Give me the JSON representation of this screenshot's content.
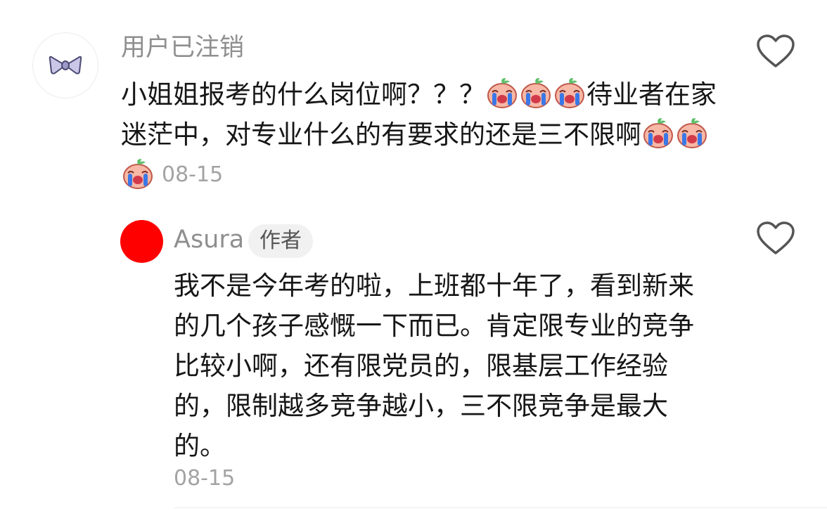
{
  "comment": {
    "username": "用户已注销",
    "text_part1": "小姐姐报考的什么岗位啊？？？",
    "text_part2": "待业者在家迷茫中，对专业什么的有要求的还是三不限啊",
    "date": "08-15",
    "emoji_name": "crying-emoji"
  },
  "reply": {
    "username": "Asura",
    "badge": "作者",
    "text": "我不是今年考的啦，上班都十年了，看到新来的几个孩子感慨一下而已。肯定限专业的竞争比较小啊，还有限党员的，限基层工作经验的，限制越多竞争越小，三不限竞争是最大的。",
    "date": "08-15"
  },
  "icons": {
    "like": "heart-outline-icon",
    "avatar_bow": "bow-icon"
  },
  "colors": {
    "meta_gray": "#8f8f8f",
    "avatar_red": "#ff0000",
    "badge_bg": "#f1f1f1"
  }
}
